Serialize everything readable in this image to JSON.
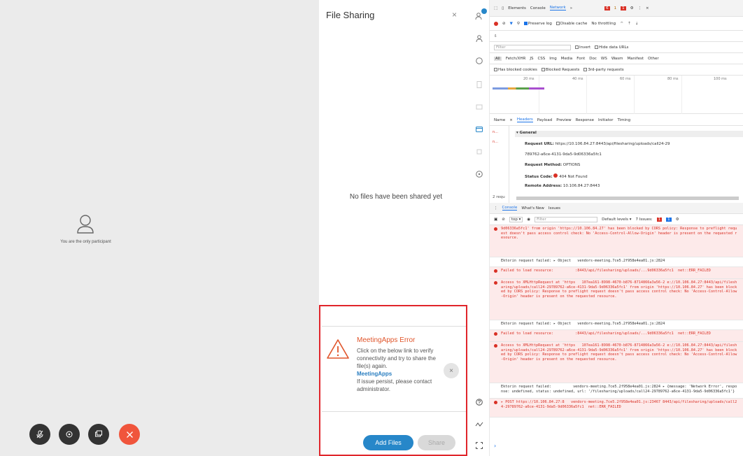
{
  "meeting": {
    "only_participant": "You are the only participant",
    "controls": [
      "mute-icon",
      "video-icon",
      "share-icon",
      "end-call-icon"
    ]
  },
  "file_sharing": {
    "title": "File Sharing",
    "close": "×",
    "empty": "No files have been shared yet",
    "error": {
      "title": "MeetingApps Error",
      "line1": "Click on the below link to verify connectivity and try to share the file(s) again.",
      "link": "MeetingApps",
      "line2": "If issue persist, please contact administrator.",
      "dismiss": "×"
    },
    "add_files": "Add Files",
    "share": "Share"
  },
  "devtools": {
    "tabs": [
      "Elements",
      "Console",
      "Network"
    ],
    "active_tab": "Network",
    "more": "»",
    "error_count": "6",
    "warn_count": "1",
    "msg_count": "1",
    "toolbar": {
      "preserve_log": "Preserve log",
      "disable_cache": "Disable cache",
      "throttling": "No throttling"
    },
    "filter": {
      "placeholder": "Filter",
      "invert": "Invert",
      "hide_data": "Hide data URLs"
    },
    "types": [
      "All",
      "Fetch/XHR",
      "JS",
      "CSS",
      "Img",
      "Media",
      "Font",
      "Doc",
      "WS",
      "Wasm",
      "Manifest",
      "Other"
    ],
    "blocked": {
      "cookies": "Has blocked cookies",
      "requests": "Blocked Requests",
      "third_party": "3rd-party requests"
    },
    "timeline": [
      "20 ms",
      "40 ms",
      "60 ms",
      "80 ms",
      "100 ms"
    ],
    "detail_tabs": [
      "Name",
      "×",
      "Headers",
      "Payload",
      "Preview",
      "Response",
      "Initiator",
      "Timing"
    ],
    "requests": [
      "n...",
      "n..."
    ],
    "general": "▾ General",
    "headers": {
      "url_label": "Request URL:",
      "url": "https://10.106.84.27:8443/api/filesharing/uploads/call24-29",
      "url2": "789762-a6ce-4131-9da5-9d06336a5fc1",
      "method_label": "Request Method:",
      "method": "OPTIONS",
      "status_label": "Status Code:",
      "status": "404 Not Found",
      "remote_label": "Remote Address:",
      "remote": "10.106.84.27:8443"
    },
    "req_count": "2 requ",
    "drawer_tabs": [
      "Console",
      "What's New",
      "Issues"
    ],
    "console_toolbar": {
      "context": "top ▾",
      "filter": "Filter",
      "levels": "Default levels ▾",
      "issues": "7 Issues:",
      "issues_err": "1",
      "issues_info": "1"
    },
    "console": [
      {
        "kind": "err",
        "text": "9d06336a5fc1' from origin 'https://10.106.84.27' has been blocked by CORS policy: Response to preflight request doesn't pass access control check: No 'Access-Control-Allow-Origin' header is present on the requested resource."
      },
      {
        "kind": "log",
        "text": "Ektorin request failed: ▸ Object   vendors-meeting.7ce5.2f958e4ea01.js:2824"
      },
      {
        "kind": "err",
        "text": "Failed to load resource:          :8443/api/filesharing/uploads/...9d06336a5fc1  net::ERR_FAILED"
      },
      {
        "kind": "err",
        "text": "Access to XMLHttpRequest at 'https   107ea161-8998-4670-b876-8714866a3a56-2 e://10.106.84.27:8443/api/filesharing/uploads/call24-29789762-a6ce-4131-9da5-9d06336a5fc1' from origin 'https://10.106.84.27' has been blocked by CORS policy: Response to preflight request doesn't pass access control check: No 'Access-Control-Allow-Origin' header is present on the requested resource."
      },
      {
        "kind": "log",
        "text": "Ektorin request failed: ▸ Object   vendors-meeting.7ce5.2f958e4ea01.js:2824"
      },
      {
        "kind": "err",
        "text": "Failed to load resource:          :8443/api/filesharing/uploads/...9d06336a5fc1  net::ERR_FAILED"
      },
      {
        "kind": "err",
        "text": "Access to XMLHttpRequest at 'https   107ea161-8998-4670-b876-8714866a3a56-2 e://10.106.84.27:8443/api/filesharing/uploads/call24-29789762-a6ce-4131-9da5-9d06336a5fc1' from origin 'https://10.106.84.27' has been blocked by CORS policy: Response to preflight request doesn't pass access control check: No 'Access-Control-Allow-Origin' header is present on the requested resource."
      },
      {
        "kind": "log",
        "text": "Ektorin request failed:          vendors-meeting.7ce5.2f958e4ea01.js:2824 ▸ {message: 'Network Error', response: undefined, status: undefined, url: '/filesharing/uploads/call24-29789762-a6ce-4131-9da5-9d06336a5fc1'}"
      },
      {
        "kind": "err",
        "text": "▸ POST https://10.106.84.27:8   vendors-meeting.7ce5.2f958e4ea01.js:23467 8443/api/filesharing/uploads/call24-29789762-a6ce-4131-9da5-9d06336a5fc1  net::ERR_FAILED"
      }
    ],
    "prompt": "›"
  }
}
